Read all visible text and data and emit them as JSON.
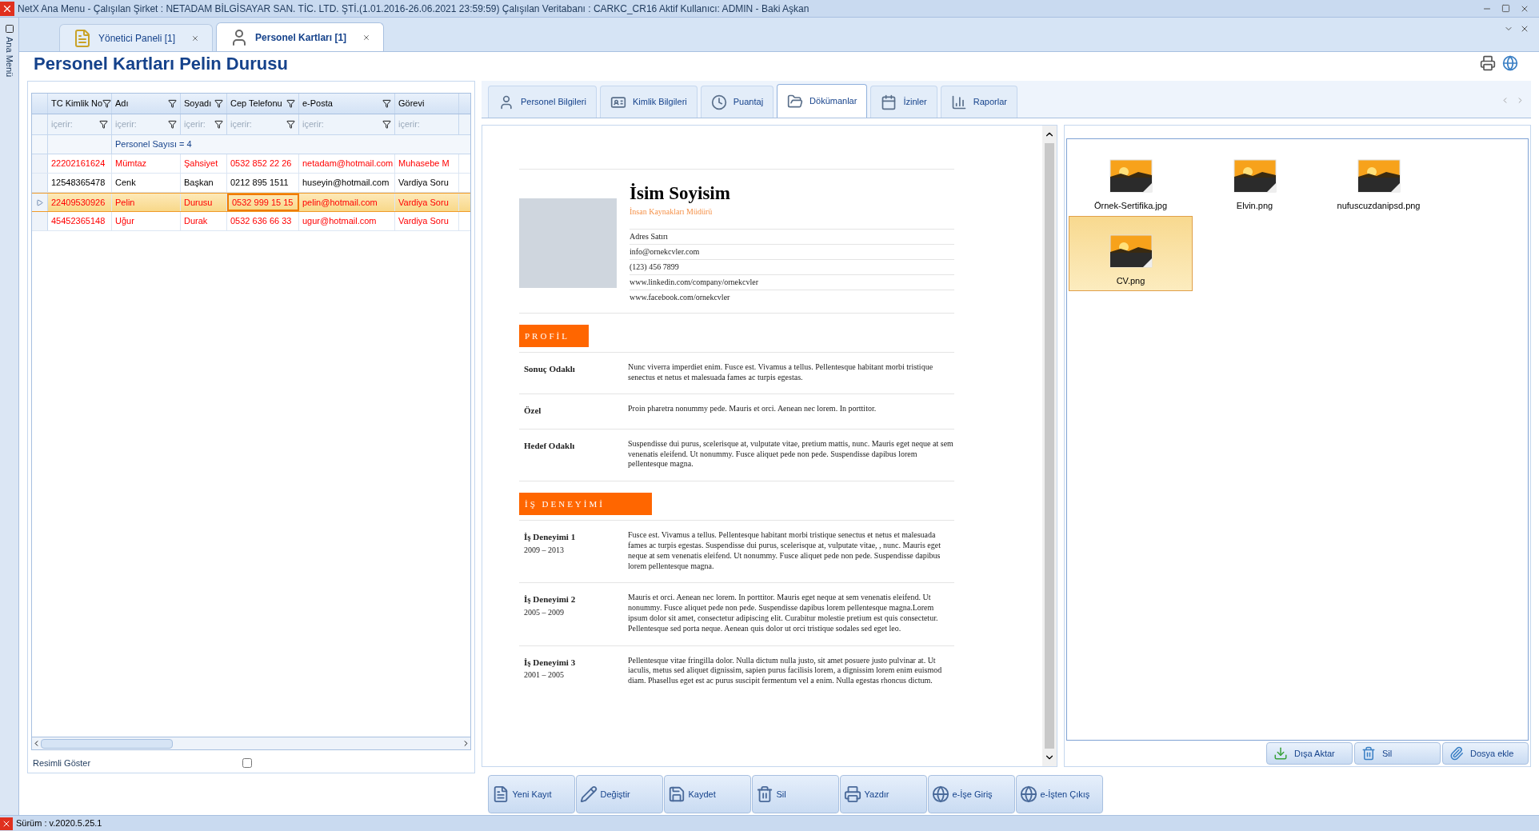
{
  "window": {
    "title": "NetX Ana Menu - Çalışılan Şirket : NETADAM BİLGİSAYAR SAN. TİC. LTD. ŞTİ.(1.01.2016-26.06.2021 23:59:59) Çalışılan Veritabanı : CARKC_CR16  Aktif Kullanıcı: ADMIN - Baki Aşkan"
  },
  "side_menu": {
    "label": "Ana Menü"
  },
  "tabs": [
    {
      "label": "Yönetici Paneli [1]",
      "selected": false
    },
    {
      "label": "Personel Kartları [1]",
      "selected": true
    }
  ],
  "heading": "Personel Kartları Pelin Durusu",
  "grid": {
    "columns": [
      "TC Kimlik No",
      "Adı",
      "Soyadı",
      "Cep Telefonu",
      "e-Posta",
      "Görevi"
    ],
    "filter_placeholders": [
      "içerir:",
      "içerir:",
      "içerir:",
      "içerir:",
      "içerir:",
      "içerir:"
    ],
    "summary": "Personel Sayısı = 4",
    "rows": [
      {
        "selected": false,
        "flagged": true,
        "cells": [
          {
            "text": "22202161624",
            "focused": false
          },
          {
            "text": "Mümtaz",
            "focused": false
          },
          {
            "text": "Şahsiyet",
            "focused": false
          },
          {
            "text": "0532 852 22 26",
            "focused": false
          },
          {
            "text": "netadam@hotmail.com",
            "focused": false
          },
          {
            "text": "Muhasebe M",
            "focused": false
          }
        ]
      },
      {
        "selected": false,
        "flagged": false,
        "cells": [
          {
            "text": "12548365478",
            "focused": false
          },
          {
            "text": "Cenk",
            "focused": false
          },
          {
            "text": "Başkan",
            "focused": false
          },
          {
            "text": "0212 895 1511",
            "focused": false
          },
          {
            "text": "huseyin@hotmail.com",
            "focused": false
          },
          {
            "text": "Vardiya Soru",
            "focused": false
          }
        ]
      },
      {
        "selected": true,
        "flagged": true,
        "cells": [
          {
            "text": "22409530926",
            "focused": false
          },
          {
            "text": "Pelin",
            "focused": false
          },
          {
            "text": "Durusu",
            "focused": false
          },
          {
            "text": "0532 999 15 15",
            "focused": true
          },
          {
            "text": "pelin@hotmail.com",
            "focused": false
          },
          {
            "text": "Vardiya Soru",
            "focused": false
          }
        ]
      },
      {
        "selected": false,
        "flagged": true,
        "cells": [
          {
            "text": "45452365148",
            "focused": false
          },
          {
            "text": "Uğur",
            "focused": false
          },
          {
            "text": "Durak",
            "focused": false
          },
          {
            "text": "0532 636 66 33",
            "focused": false
          },
          {
            "text": "ugur@hotmail.com",
            "focused": false
          },
          {
            "text": "Vardiya Soru",
            "focused": false
          }
        ]
      }
    ]
  },
  "show_pictures": {
    "label": "Resimli Göster",
    "checked": false
  },
  "detail_tabs": [
    {
      "label": "Personel Bilgileri",
      "selected": false
    },
    {
      "label": "Kimlik Bilgileri",
      "selected": false
    },
    {
      "label": "Puantaj",
      "selected": false
    },
    {
      "label": "Dökümanlar",
      "selected": true
    },
    {
      "label": "İzinler",
      "selected": false
    },
    {
      "label": "Raporlar",
      "selected": false
    }
  ],
  "cv": {
    "name": "İsim Soyisim",
    "title": "İnsan Kaynakları Müdürü",
    "contacts": [
      "Adres Satırı",
      "info@ornekcvler.com",
      "(123) 456 7899",
      "www.linkedin.com/company/ornekcvler",
      "www.facebook.com/ornekcvler"
    ],
    "sections": [
      {
        "heading": "PROFİL",
        "entries": [
          {
            "label": "Sonuç Odaklı",
            "text": "Nunc viverra imperdiet enim. Fusce est. Vivamus a tellus. Pellentesque habitant morbi tristique senectus et netus et malesuada fames ac turpis egestas."
          },
          {
            "label": "Özel",
            "text": "Proin pharetra nonummy pede. Mauris et orci. Aenean nec lorem. In porttitor."
          },
          {
            "label": "Hedef Odaklı",
            "text": "Suspendisse dui purus, scelerisque at, vulputate vitae, pretium mattis, nunc. Mauris eget neque at sem venenatis eleifend. Ut nonummy. Fusce aliquet pede non pede. Suspendisse dapibus lorem pellentesque magna."
          }
        ]
      },
      {
        "heading": "İŞ DENEYİMİ",
        "entries": [
          {
            "label": "İş Deneyimi 1",
            "period": "2009 – 2013",
            "text": "Fusce est. Vivamus a tellus. Pellentesque habitant morbi tristique senectus et netus et malesuada fames ac turpis egestas. Suspendisse dui purus, scelerisque at, vulputate vitae, , nunc. Mauris eget neque at sem venenatis eleifend. Ut nonummy. Fusce aliquet pede non pede. Suspendisse dapibus lorem pellentesque magna."
          },
          {
            "label": "İş Deneyimi 2",
            "period": "2005 – 2009",
            "text": "Mauris et orci. Aenean nec lorem. In porttitor. Mauris eget neque at sem venenatis eleifend. Ut nonummy. Fusce aliquet pede non pede. Suspendisse dapibus lorem pellentesque magna.Lorem ipsum dolor sit amet, consectetur adipiscing elit. Curabitur molestie pretium est quis consectetur. Pellentesque sed porta neque. Aenean quis dolor ut orci tristique sodales sed eget leo."
          },
          {
            "label": "İş Deneyimi 3",
            "period": "2001 – 2005",
            "text": "Pellentesque vitae fringilla dolor. Nulla dictum nulla justo, sit amet posuere justo pulvinar at. Ut iaculis, metus sed aliquet dignissim, sapien purus facilisis lorem, a dignissim lorem enim euismod diam. Phasellus eget est ac purus suscipit fermentum vel a enim. Nulla egestas rhoncus dictum."
          }
        ]
      }
    ]
  },
  "files": [
    {
      "name": "Örnek-Sertifika.jpg",
      "selected": false
    },
    {
      "name": "Elvin.png",
      "selected": false
    },
    {
      "name": "nufuscuzdanipsd.png",
      "selected": false
    },
    {
      "name": "CV.png",
      "selected": true
    }
  ],
  "file_buttons": [
    "Dışa Aktar",
    "Sil",
    "Dosya ekle"
  ],
  "action_buttons": [
    "Yeni Kayıt",
    "Değiştir",
    "Kaydet",
    "Sil",
    "Yazdır",
    "e-İşe Giriş",
    "e-İşten Çıkış"
  ],
  "status_bar": {
    "version": "Sürüm : v.2020.5.25.1"
  }
}
